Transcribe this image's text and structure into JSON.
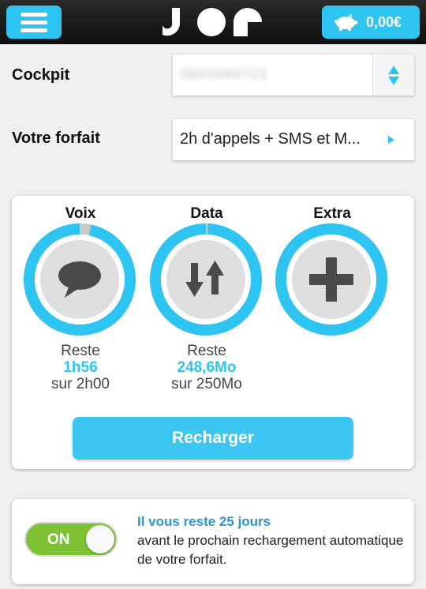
{
  "header": {
    "menu_icon": "hamburger-icon",
    "logo_icon": "joe-logo",
    "wallet_icon": "piggy-bank-icon",
    "balance": "0,00€"
  },
  "cockpit": {
    "label": "Cockpit",
    "value": "0601040723",
    "stepper_icon": "up-down-arrows-icon"
  },
  "forfait": {
    "label": "Votre forfait",
    "value": "2h d'appels + SMS et M...",
    "arrow_icon": "play-right-icon"
  },
  "usage": {
    "gauges": [
      {
        "title": "Voix",
        "icon": "speech-bubble-icon",
        "reste_label": "Reste",
        "value": "1h56",
        "total": "sur 2h00",
        "remaining_fraction": 0.967
      },
      {
        "title": "Data",
        "icon": "up-down-transfer-icon",
        "reste_label": "Reste",
        "value": "248,6Mo",
        "total": "sur 250Mo",
        "remaining_fraction": 0.994
      },
      {
        "title": "Extra",
        "icon": "plus-icon",
        "remaining_fraction": 1.0
      }
    ],
    "recharge_label": "Recharger"
  },
  "auto_recharge": {
    "toggle_label": "ON",
    "headline": "Il vous reste 25 jours",
    "body": "avant le prochain rechargement automatique de votre forfait."
  },
  "colors": {
    "accent": "#2ec4f2",
    "toggle_on": "#7cc232",
    "highlight_text": "#2b95d4",
    "top_bar": "#1a1a1a"
  }
}
